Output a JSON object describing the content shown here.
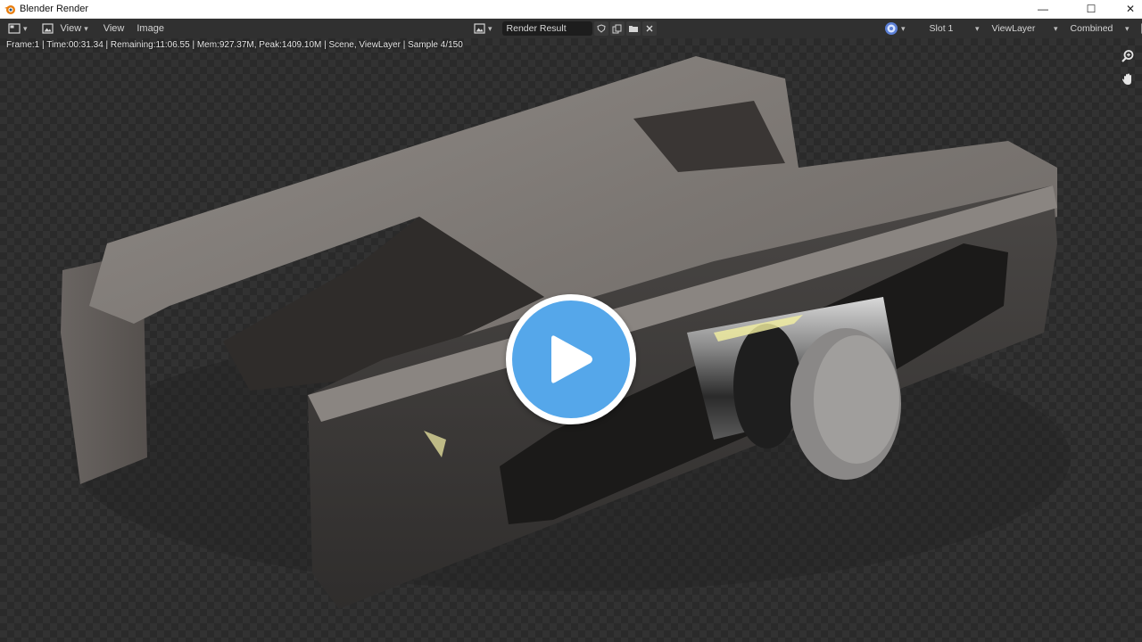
{
  "window": {
    "title": "Blender Render",
    "controls": {
      "minimize": "—",
      "maximize": "☐",
      "close": "✕"
    }
  },
  "header": {
    "editor_type_icon": "image-editor-icon",
    "view_menu_label": "View",
    "menus": [
      "View",
      "Image"
    ],
    "image_name": "Render Result",
    "slot": "Slot 1",
    "view_layer": "ViewLayer",
    "pass": "Combined"
  },
  "info_line": "Frame:1 | Time:00:31.34 | Remaining:11:06.55 | Mem:927.37M, Peak:1409.10M | Scene, ViewLayer | Sample 4/150",
  "tools": [
    "zoom-icon",
    "hand-pan-icon"
  ],
  "overlay": {
    "icon": "play-icon",
    "accent": "#55a7ea"
  }
}
